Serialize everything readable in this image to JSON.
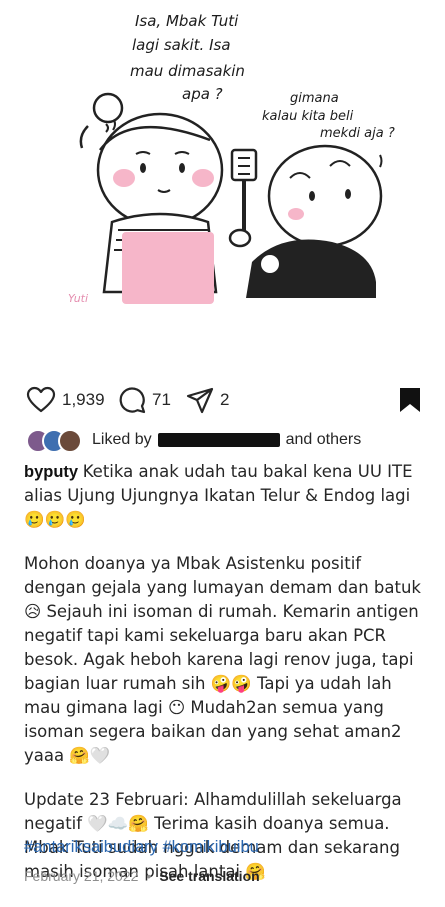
{
  "post": {
    "illustration": {
      "speech_left": [
        "Isa, Mbak Tuti",
        "lagi sakit. Isa",
        "mau dimasakin",
        "apa ?"
      ],
      "speech_right": [
        "gimana",
        "kalau kita beli",
        "mekdi aja ?"
      ],
      "signature": "Yuti"
    },
    "actions": {
      "likes": "1,939",
      "comments": "71",
      "shares": "2"
    },
    "liked_by": {
      "prefix": "Liked by",
      "suffix": "and others"
    },
    "caption": {
      "username": "byputy",
      "p1": "Ketika anak udah tau bakal kena UU ITE alias Ujung Ujungnya Ikatan Telur & Endog lagi 🥲🥲🥲",
      "p2": "Mohon doanya ya Mbak Asistenku positif dengan gejala yang lumayan demam dan batuk 😥 Sejauh ini isoman di rumah. Kemarin antigen negatif tapi kami sekeluarga baru akan PCR besok. Agak heboh karena lagi renov juga, tapi bagian luar rumah sih 🤪🤪 Tapi ya udah lah mau gimana lagi 😶 Mudah2an semua yang isoman segera baikan dan yang sehat aman2 yaaa 🤗🤍",
      "p3": "Update 23 Februari: Alhamdulillah sekeluarga negatif 🤍☁️🤗 Terima kasih doanya semua. Mbak Tuti sudah nggak demam dan sekarang masih isoman pisah lantai 🤗"
    },
    "hashtags": "#antariksaibudiary #komikibuibu",
    "date": "February 21, 2022",
    "separator": "•",
    "see_translation": "See translation",
    "colors": {
      "link": "#2a67b0",
      "meta": "#8e8e8e",
      "pink": "#f6b6c9"
    },
    "icons": [
      "heart-icon",
      "comment-icon",
      "share-icon",
      "bookmark-icon"
    ]
  }
}
